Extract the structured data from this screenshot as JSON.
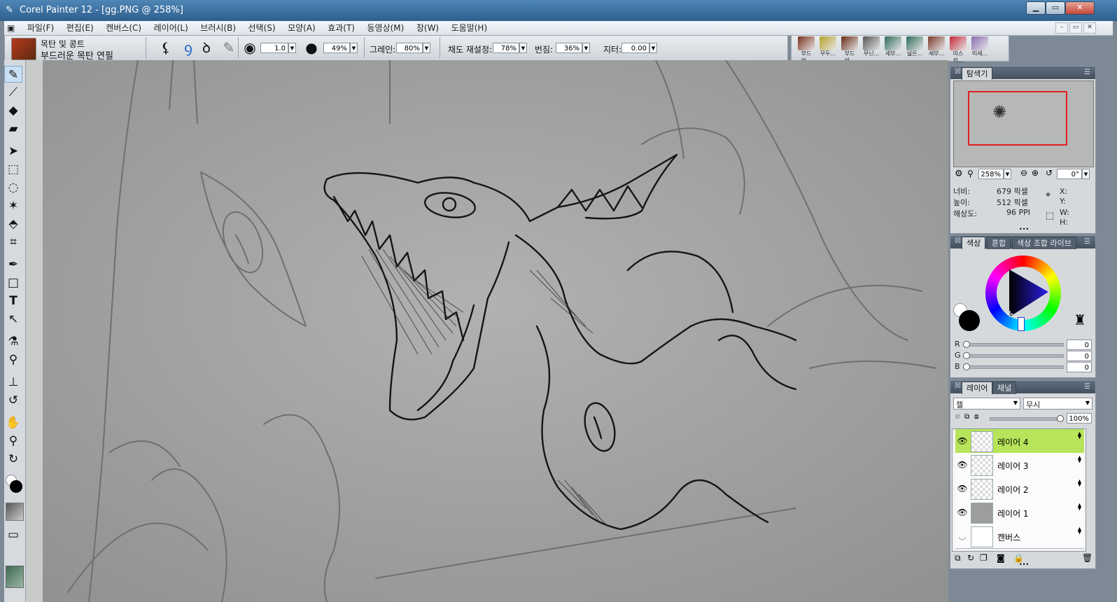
{
  "window": {
    "title": "Corel Painter 12 - [gg.PNG @ 258%]",
    "buttons": {
      "minimize": "▁",
      "maximize": "▭",
      "close": "✕"
    }
  },
  "menubar": {
    "items": [
      "파일(F)",
      "편집(E)",
      "캔버스(C)",
      "레이어(L)",
      "브러시(B)",
      "선택(S)",
      "모양(A)",
      "효과(T)",
      "동영상(M)",
      "창(W)",
      "도움말(H)"
    ],
    "doc_buttons": [
      "–",
      "▭",
      "✕"
    ]
  },
  "property_bar": {
    "brush_category": "목탄 및 콩트",
    "brush_variant": "부드러운 목탄 연필",
    "size_value": "1.0",
    "opacity_value": "49%",
    "grain_label": "그레인:",
    "grain_value": "80%",
    "resat_label": "채도 재설정:",
    "resat_value": "78%",
    "bleed_label": "번짐:",
    "bleed_value": "36%",
    "jitter_label": "지터:",
    "jitter_value": "0.00"
  },
  "brush_strip": {
    "items": [
      {
        "label": "부드러...",
        "color": "#7a2e1a"
      },
      {
        "label": "무두...",
        "color": "#b7a22a"
      },
      {
        "label": "부드러...",
        "color": "#6a2a14"
      },
      {
        "label": "무닌...",
        "color": "#555555"
      },
      {
        "label": "세부...",
        "color": "#2e6a5a"
      },
      {
        "label": "넓은...",
        "color": "#2e6a5a"
      },
      {
        "label": "세부...",
        "color": "#7a3a2a"
      },
      {
        "label": "미스키...",
        "color": "#c6283a"
      },
      {
        "label": "미세...",
        "color": "#8a6ab0"
      }
    ]
  },
  "navigator": {
    "tab": "탐색기",
    "zoom": "258%",
    "rotation": "0°",
    "width_label": "너비:",
    "width_value": "679 픽셀",
    "height_label": "높이:",
    "height_value": "512 픽셀",
    "res_label": "해상도:",
    "res_value": "96 PPI",
    "x_label": "X:",
    "y_label": "Y:",
    "w_label": "W:",
    "h_label": "H:"
  },
  "color_panel": {
    "tabs": [
      "색상",
      "혼합",
      "색상 조합 라이브"
    ],
    "r_label": "R",
    "g_label": "G",
    "b_label": "B",
    "r_value": "0",
    "g_value": "0",
    "b_value": "0"
  },
  "layers_panel": {
    "tabs": [
      "레이어",
      "채널"
    ],
    "blend_mode": "젤",
    "composite": "무시",
    "opacity": "100%",
    "opacity_level": 1.0,
    "layers": [
      {
        "name": "레이어 4",
        "selected": true
      },
      {
        "name": "레이어 3",
        "selected": false
      },
      {
        "name": "레이어 2",
        "selected": false
      },
      {
        "name": "레이어 1",
        "selected": false
      },
      {
        "name": "캔버스",
        "selected": false
      }
    ]
  },
  "colors": {
    "selected_layer": "#b7e45a",
    "title_bar": "#3a6e9e"
  }
}
